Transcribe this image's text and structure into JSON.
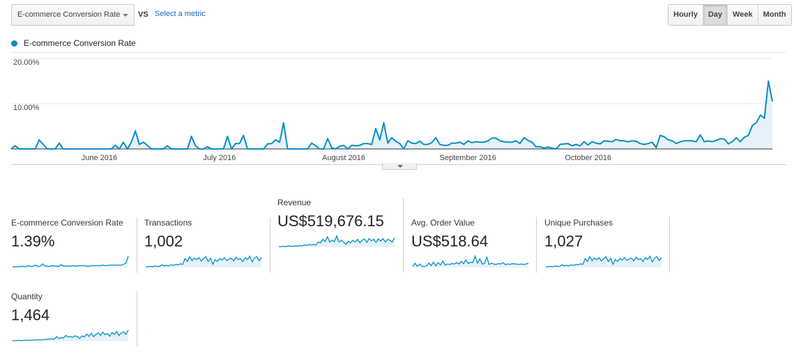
{
  "header": {
    "primary_metric": "E-commerce Conversion Rate",
    "vs_label": "VS",
    "secondary_metric_link": "Select a metric",
    "granularity": [
      {
        "label": "Hourly",
        "active": false
      },
      {
        "label": "Day",
        "active": true
      },
      {
        "label": "Week",
        "active": false
      },
      {
        "label": "Month",
        "active": false
      }
    ]
  },
  "colors": {
    "series_line": "#058dc7",
    "series_fill": "#e6f2f9",
    "gridline": "#e6e6e6",
    "axis": "#333333"
  },
  "chart_data": {
    "type": "area",
    "title": "",
    "legend": [
      "E-commerce Conversion Rate"
    ],
    "legend_position": "top-left",
    "ylabel": "",
    "xlabel": "",
    "ylim": [
      0,
      20
    ],
    "yticks": [
      {
        "value": 20,
        "label": "20.00%"
      },
      {
        "value": 10,
        "label": "10.00%"
      }
    ],
    "x_start": "2016-05-10",
    "x_end": "2016-10-31",
    "xticks": [
      {
        "day_index": 22,
        "label": "June 2016"
      },
      {
        "day_index": 52,
        "label": "July 2016"
      },
      {
        "day_index": 83,
        "label": "August 2016"
      },
      {
        "day_index": 114,
        "label": "September 2016"
      },
      {
        "day_index": 144,
        "label": "October 2016"
      }
    ],
    "series": [
      {
        "name": "E-commerce Conversion Rate",
        "unit": "%",
        "values": [
          0,
          0.7,
          0,
          0,
          0,
          0,
          0,
          2.0,
          1.0,
          0,
          0,
          0,
          1.3,
          0,
          0,
          0,
          0,
          0,
          0,
          0,
          0,
          0,
          0,
          0,
          0,
          0,
          0.8,
          0,
          1.5,
          0,
          1.5,
          4.0,
          1.0,
          1.5,
          0.8,
          0,
          0,
          0,
          0,
          0.7,
          0,
          0,
          0,
          0,
          0,
          2.8,
          0.7,
          0,
          0,
          0.5,
          0,
          0,
          0,
          0,
          2.8,
          0,
          1.2,
          1.2,
          3.0,
          0,
          0,
          0,
          0,
          0,
          1.1,
          1.2,
          2.0,
          1.5,
          5.8,
          0,
          0,
          0,
          0,
          0,
          0,
          1.3,
          0.7,
          0,
          0,
          2.3,
          0.3,
          0,
          0.6,
          0.8,
          0,
          0.8,
          0.7,
          0.8,
          1.2,
          1.2,
          1.0,
          4.5,
          2.0,
          5.8,
          1.3,
          2.5,
          1.7,
          1.2,
          0,
          1.8,
          1.3,
          1.2,
          1.7,
          1.0,
          1.0,
          1.4,
          2.5,
          1.0,
          0.8,
          0.8,
          1.3,
          1.3,
          1.5,
          1.0,
          1.8,
          1.4,
          1.6,
          1.5,
          1.5,
          1.8,
          2.4,
          2.4,
          1.8,
          1.6,
          1.5,
          1.5,
          1.8,
          1.2,
          2.5,
          1.9,
          1.5,
          0.5,
          0.5,
          0.2,
          0.4,
          0.2,
          0,
          1.0,
          1.1,
          1.2,
          0.7,
          1.0,
          0.7,
          1.6,
          0.9,
          1.6,
          1.3,
          1.1,
          1.8,
          1.7,
          1.6,
          2.1,
          1.8,
          1.8,
          1.6,
          1.8,
          1.7,
          1.2,
          1.0,
          1.2,
          1.5,
          0.3,
          3.0,
          2.7,
          2.0,
          1.8,
          1.2,
          1.6,
          1.8,
          1.8,
          1.8,
          1.6,
          3.1,
          1.6,
          1.8,
          1.6,
          1.9,
          2.3,
          2.2,
          1.1,
          1.6,
          2.5,
          1.6,
          2.6,
          3.0,
          5.2,
          5.8,
          7.5,
          6.8,
          15.0,
          10.5
        ]
      }
    ]
  },
  "scorecards": [
    {
      "title": "E-commerce Conversion Rate",
      "value": "1.39%",
      "spark": [
        0.1,
        0.1,
        0.2,
        0.1,
        0.3,
        0.1,
        0.2,
        0.4,
        0.2,
        0.3,
        0.5,
        0.2,
        0.3,
        0.8,
        0.3,
        0.3,
        0.2,
        0.4,
        0.3,
        0.3,
        0.2,
        0.6,
        0.3,
        0.3,
        0.3,
        0.3,
        0.4,
        0.3,
        0.3,
        0.4,
        0.4,
        0.4,
        0.3,
        0.3,
        0.4,
        0.4,
        0.4,
        0.4,
        0.4,
        0.5,
        0.4,
        0.4,
        0.5,
        0.5,
        0.5,
        0.5,
        0.5,
        0.5,
        0.7,
        1.0,
        2.6
      ]
    },
    {
      "title": "Transactions",
      "value": "1,002",
      "spark": [
        0.1,
        0.1,
        0.2,
        0.1,
        0.3,
        0.2,
        0.2,
        0.5,
        0.3,
        0.4,
        0.3,
        0.5,
        0.4,
        0.6,
        0.5,
        0.7,
        0.6,
        1.8,
        1.2,
        2.2,
        1.4,
        1.9,
        1.6,
        2.0,
        1.3,
        1.8,
        2.2,
        1.2,
        1.9,
        0.6,
        1.6,
        1.2,
        1.8,
        1.5,
        2.0,
        1.4,
        1.7,
        1.9,
        1.3,
        2.1,
        1.6,
        1.8,
        1.2,
        2.0,
        1.6,
        2.3,
        1.1,
        1.9,
        2.2,
        1.4,
        2.0
      ]
    },
    {
      "title": "Revenue",
      "value": "US$519,676.15",
      "spark": [
        0.1,
        0.1,
        0.2,
        0.1,
        0.3,
        0.2,
        0.2,
        0.3,
        0.2,
        0.4,
        0.3,
        0.5,
        0.4,
        0.6,
        0.5,
        0.6,
        0.5,
        1.2,
        1.0,
        1.8,
        1.3,
        2.4,
        1.2,
        1.6,
        1.3,
        2.6,
        1.2,
        1.6,
        1.1,
        0.6,
        1.4,
        1.0,
        1.6,
        1.2,
        1.8,
        1.0,
        1.6,
        1.9,
        1.1,
        2.0,
        1.5,
        1.8,
        1.1,
        1.9,
        1.4,
        2.0,
        1.2,
        1.8,
        1.6,
        1.2,
        2.2
      ]
    },
    {
      "title": "Avg. Order Value",
      "value": "US$518.64",
      "spark": [
        0.2,
        0.9,
        0.2,
        0.7,
        0.2,
        0.2,
        0.3,
        0.9,
        0.4,
        1.1,
        0.3,
        1.0,
        0.5,
        1.3,
        0.5,
        0.7,
        0.6,
        0.8,
        0.7,
        1.0,
        0.7,
        1.3,
        0.8,
        1.6,
        0.8,
        1.1,
        1.0,
        2.4,
        0.9,
        1.8,
        0.7,
        0.8,
        2.2,
        0.6,
        0.9,
        0.7,
        0.6,
        0.8,
        0.7,
        1.0,
        0.6,
        0.7,
        0.6,
        0.8,
        0.7,
        0.7,
        0.6,
        0.7,
        0.6,
        0.7,
        0.9
      ]
    },
    {
      "title": "Unique Purchases",
      "value": "1,027",
      "spark": [
        0.1,
        0.1,
        0.2,
        0.1,
        0.3,
        0.2,
        0.2,
        0.5,
        0.3,
        0.4,
        0.3,
        0.5,
        0.4,
        0.6,
        0.5,
        0.7,
        0.6,
        1.8,
        1.2,
        2.2,
        1.4,
        1.9,
        1.6,
        2.0,
        1.3,
        1.8,
        2.2,
        1.2,
        1.9,
        0.6,
        1.6,
        1.2,
        1.8,
        1.5,
        2.0,
        1.4,
        1.7,
        1.9,
        1.3,
        2.1,
        1.6,
        1.8,
        1.2,
        2.0,
        1.6,
        2.3,
        1.1,
        1.9,
        2.2,
        1.4,
        2.0
      ]
    },
    {
      "title": "Quantity",
      "value": "1,464",
      "spark": [
        0.1,
        0.1,
        0.1,
        0.2,
        0.1,
        0.2,
        0.2,
        0.3,
        0.2,
        0.3,
        0.3,
        0.4,
        0.3,
        0.4,
        0.4,
        0.5,
        0.5,
        0.6,
        0.5,
        1.2,
        0.7,
        0.9,
        0.8,
        1.5,
        1.1,
        1.2,
        1.0,
        1.4,
        1.2,
        0.7,
        1.4,
        1.1,
        1.9,
        1.3,
        2.1,
        1.2,
        1.8,
        2.2,
        1.5,
        2.4,
        1.7,
        2.0,
        1.3,
        2.3,
        1.8,
        2.6,
        1.5,
        2.2,
        2.5,
        1.8,
        3.0
      ]
    }
  ]
}
